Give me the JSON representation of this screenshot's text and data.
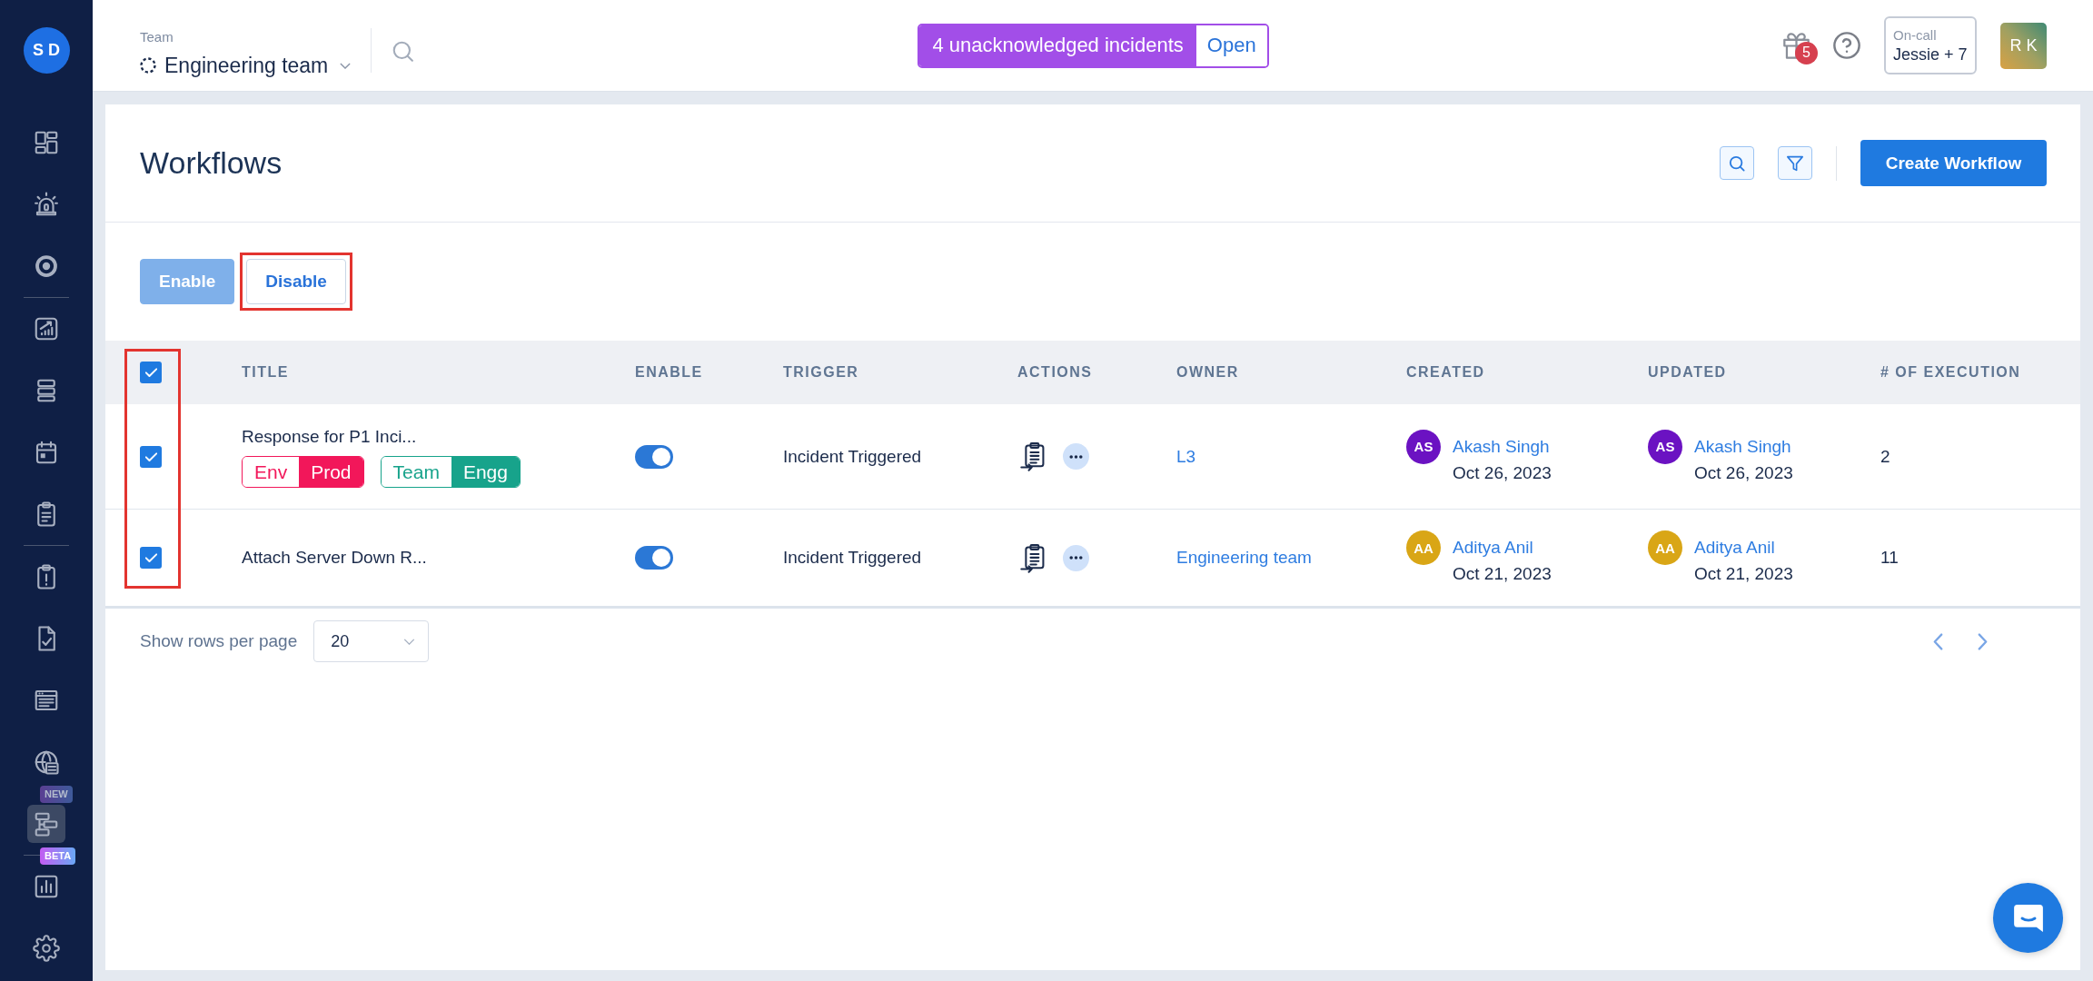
{
  "sidebar": {
    "avatar": "S D",
    "groups": [
      [
        {
          "selected": false
        },
        {
          "selected": false
        },
        {
          "selected": false
        }
      ],
      [
        {
          "selected": false
        },
        {
          "selected": false
        },
        {
          "selected": false
        },
        {
          "selected": false
        }
      ],
      [
        {
          "selected": false
        },
        {
          "selected": false
        },
        {
          "selected": false
        },
        {
          "selected": false,
          "badge": {
            "label": "NEW",
            "dimmed": true
          }
        },
        {
          "selected": true,
          "badge": {
            "label": "BETA",
            "dimmed": false
          }
        }
      ],
      [
        {
          "selected": false
        },
        {
          "selected": false
        }
      ]
    ]
  },
  "header": {
    "team": {
      "label": "Team",
      "name": "Engineering team"
    },
    "incidents": {
      "text": "4 unacknowledged incidents",
      "action": "Open"
    },
    "notifications_badge": "5",
    "on_call": {
      "label": "On-call",
      "value": "Jessie + 7"
    },
    "user_avatar": "R K"
  },
  "page": {
    "title": "Workflows",
    "create_button": "Create Workflow",
    "bulk_actions": [
      {
        "label": "Enable",
        "disabled": true,
        "highlighted": false
      },
      {
        "label": "Disable",
        "disabled": false,
        "highlighted": true
      }
    ]
  },
  "table": {
    "all_selected": true,
    "select_column_highlighted": true,
    "columns": [
      "TITLE",
      "ENABLE",
      "TRIGGER",
      "ACTIONS",
      "OWNER",
      "CREATED",
      "UPDATED",
      "# OF EXECUTION"
    ],
    "rows": [
      {
        "selected": true,
        "title": "Response for P1 Inci...",
        "tags": [
          {
            "key": "Env",
            "value": "Prod",
            "color": "#f2175a"
          },
          {
            "key": "Team",
            "value": "Engg",
            "color": "#17a38b"
          }
        ],
        "enabled": true,
        "trigger": "Incident Triggered",
        "owner": "L3",
        "created": {
          "initials": "AS",
          "name": "Akash Singh",
          "date": "Oct 26, 2023",
          "color": "#6b12c2"
        },
        "updated": {
          "initials": "AS",
          "name": "Akash Singh",
          "date": "Oct 26, 2023",
          "color": "#6b12c2"
        },
        "executions": "2"
      },
      {
        "selected": true,
        "title": "Attach Server Down R...",
        "enabled": true,
        "trigger": "Incident Triggered",
        "owner": "Engineering team",
        "created": {
          "initials": "AA",
          "name": "Aditya Anil",
          "date": "Oct 21, 2023",
          "color": "#d9a616"
        },
        "updated": {
          "initials": "AA",
          "name": "Aditya Anil",
          "date": "Oct 21, 2023",
          "color": "#d9a616"
        },
        "executions": "11"
      }
    ]
  },
  "footer": {
    "rows_per_page_label": "Show rows per page",
    "rows_per_page": "20"
  }
}
